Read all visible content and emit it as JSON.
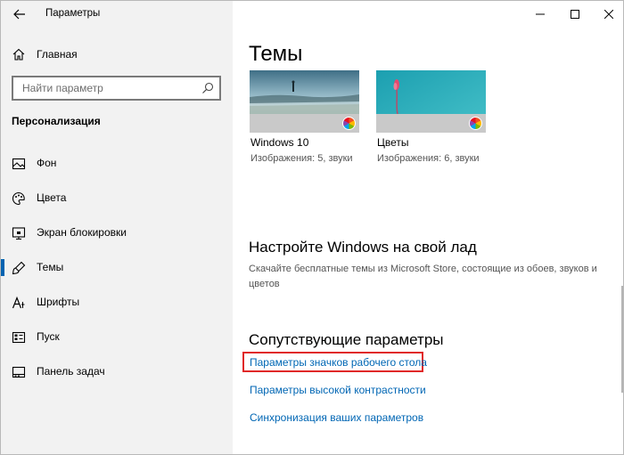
{
  "window": {
    "title": "Параметры"
  },
  "sidebar": {
    "home_label": "Главная",
    "search_placeholder": "Найти параметр",
    "section_title": "Персонализация",
    "items": [
      {
        "label": "Фон",
        "icon": "picture-icon",
        "active": false
      },
      {
        "label": "Цвета",
        "icon": "palette-icon",
        "active": false
      },
      {
        "label": "Экран блокировки",
        "icon": "lock-screen-icon",
        "active": false
      },
      {
        "label": "Темы",
        "icon": "brush-icon",
        "active": true
      },
      {
        "label": "Шрифты",
        "icon": "font-icon",
        "active": false
      },
      {
        "label": "Пуск",
        "icon": "start-icon",
        "active": false
      },
      {
        "label": "Панель задач",
        "icon": "taskbar-icon",
        "active": false
      }
    ]
  },
  "main": {
    "page_title": "Темы",
    "themes": [
      {
        "name": "Windows 10",
        "desc": "Изображения: 5, звуки"
      },
      {
        "name": "Цветы",
        "desc": "Изображения: 6, звуки"
      }
    ],
    "customize_heading": "Настройте Windows на свой лад",
    "customize_text": "Скачайте бесплатные темы из Microsoft Store, состоящие из обоев, звуков и цветов",
    "related_heading": "Сопутствующие параметры",
    "links": [
      "Параметры значков рабочего стола",
      "Параметры высокой контрастности",
      "Синхронизация ваших параметров"
    ]
  },
  "colors": {
    "accent": "#0063b1",
    "link": "#0066b4",
    "highlight_border": "#e02828",
    "sidebar_bg": "#f2f2f2"
  }
}
